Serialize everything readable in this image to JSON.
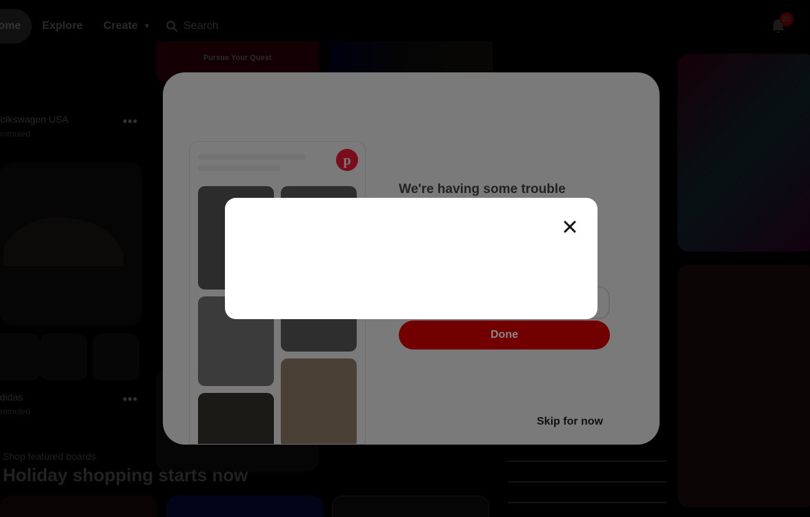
{
  "header": {
    "nav": {
      "home": "Home",
      "explore": "Explore",
      "create": "Create"
    },
    "search_placeholder": "Search",
    "notification_count": "20"
  },
  "feed": {
    "promo_text": "Pursue Your Quest",
    "pins": [
      {
        "brand": "Volkswagen USA",
        "sub": "Promoted"
      },
      {
        "brand": "adidas",
        "sub": "Promoted"
      }
    ],
    "featured": {
      "kicker": "Shop featured boards",
      "title": "Holiday shopping starts now"
    }
  },
  "signup_modal": {
    "heading": "We're having some trouble",
    "done_label": "Done",
    "skip_label": "Skip for now"
  },
  "error_dialog": {
    "close_icon": "close-icon"
  },
  "colors": {
    "brand_red": "#e60023",
    "dimmed_red": "#730000",
    "dialog_bg": "#ffffff"
  }
}
